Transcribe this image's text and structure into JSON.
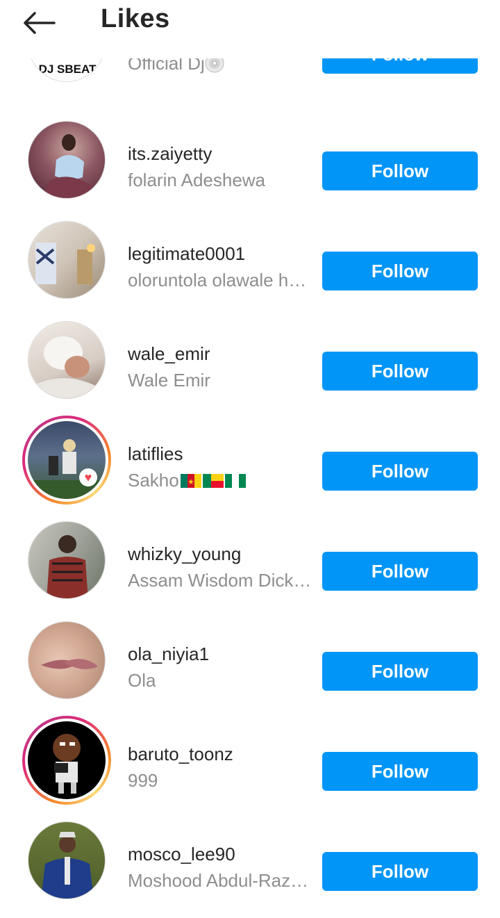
{
  "header": {
    "title": "Likes",
    "back_icon": "arrow-left-icon"
  },
  "colors": {
    "follow_button": "#0095f6",
    "primary_text": "#262626",
    "secondary_text": "#8e8e8e"
  },
  "users": [
    {
      "username": "",
      "full_name": "Official Dj",
      "avatar_logo": "DJ SBEAT",
      "button": "Follow"
    },
    {
      "username": "its.zaiyetty",
      "full_name": "folarin Adeshewa",
      "button": "Follow"
    },
    {
      "username": "legitimate0001",
      "full_name": "oloruntola olawale h…",
      "button": "Follow"
    },
    {
      "username": "wale_emir",
      "full_name": "Wale Emir",
      "button": "Follow"
    },
    {
      "username": "latiflies",
      "full_name": "Sakho",
      "button": "Follow"
    },
    {
      "username": "whizky_young",
      "full_name": "Assam Wisdom Dick…",
      "button": "Follow"
    },
    {
      "username": "ola_niyia1",
      "full_name": "Ola",
      "button": "Follow"
    },
    {
      "username": "baruto_toonz",
      "full_name": "999",
      "button": "Follow"
    },
    {
      "username": "mosco_lee90",
      "full_name": "Moshood Abdul-Raz…",
      "button": "Follow"
    }
  ]
}
